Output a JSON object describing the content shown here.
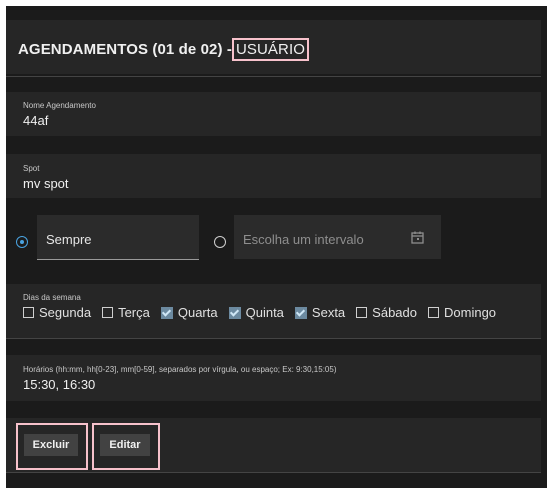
{
  "header": {
    "title_prefix": "AGENDAMENTOS (01 de 02) -",
    "title_highlight": "USUÁRIO"
  },
  "nome_agendamento": {
    "label": "Nome Agendamento",
    "value": "44af"
  },
  "spot": {
    "label": "Spot",
    "value": "mv spot"
  },
  "period": {
    "always_label": "Sempre",
    "interval_placeholder": "Escolha um intervalo",
    "selected": "always"
  },
  "weekdays": {
    "label": "Dias da semana",
    "days": [
      {
        "label": "Segunda",
        "checked": false
      },
      {
        "label": "Terça",
        "checked": false
      },
      {
        "label": "Quarta",
        "checked": true
      },
      {
        "label": "Quinta",
        "checked": true
      },
      {
        "label": "Sexta",
        "checked": true
      },
      {
        "label": "Sábado",
        "checked": false
      },
      {
        "label": "Domingo",
        "checked": false
      }
    ]
  },
  "horarios": {
    "label": "Horários (hh:mm, hh[0-23], mm[0-59], separados por vírgula, ou espaço; Ex: 9:30,15:05)",
    "value": "15:30, 16:30"
  },
  "actions": {
    "delete_label": "Excluir",
    "edit_label": "Editar"
  },
  "colors": {
    "checked_box": "#6c8aa0",
    "radio_accent": "#4aa3e0",
    "highlight_border": "#f7c2cc"
  },
  "icons": {
    "calendar": "calendar-icon"
  }
}
